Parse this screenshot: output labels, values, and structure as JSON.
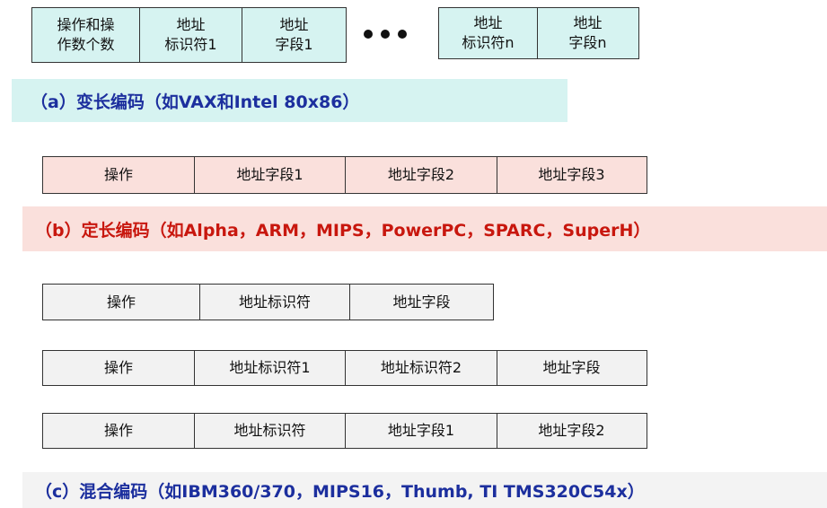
{
  "variable": {
    "group1": [
      "操作和操\n作数个数",
      "地址\n标识符1",
      "地址\n字段1"
    ],
    "group2": [
      "地址\n标识符n",
      "地址\n字段n"
    ],
    "caption": "（a）变长编码（如VAX和Intel 80x86）"
  },
  "fixed": {
    "cells": [
      "操作",
      "地址字段1",
      "地址字段2",
      "地址字段3"
    ],
    "caption": "（b）定长编码（如Alpha，ARM，MIPS，PowerPC，SPARC，SuperH）"
  },
  "hybrid": {
    "row1": [
      "操作",
      "地址标识符",
      "地址字段"
    ],
    "row2": [
      "操作",
      "地址标识符1",
      "地址标识符2",
      "地址字段"
    ],
    "row3": [
      "操作",
      "地址标识符",
      "地址字段1",
      "地址字段2"
    ],
    "caption": "（c）混合编码（如IBM360/370，MIPS16，Thumb, TI TMS320C54x）"
  },
  "colors": {
    "variable_fill": "#d6f3f1",
    "fixed_fill": "#fae0dc",
    "hybrid_fill": "#f2f2f2",
    "caption_blue": "#1c2f9e",
    "caption_red": "#c8170e"
  }
}
